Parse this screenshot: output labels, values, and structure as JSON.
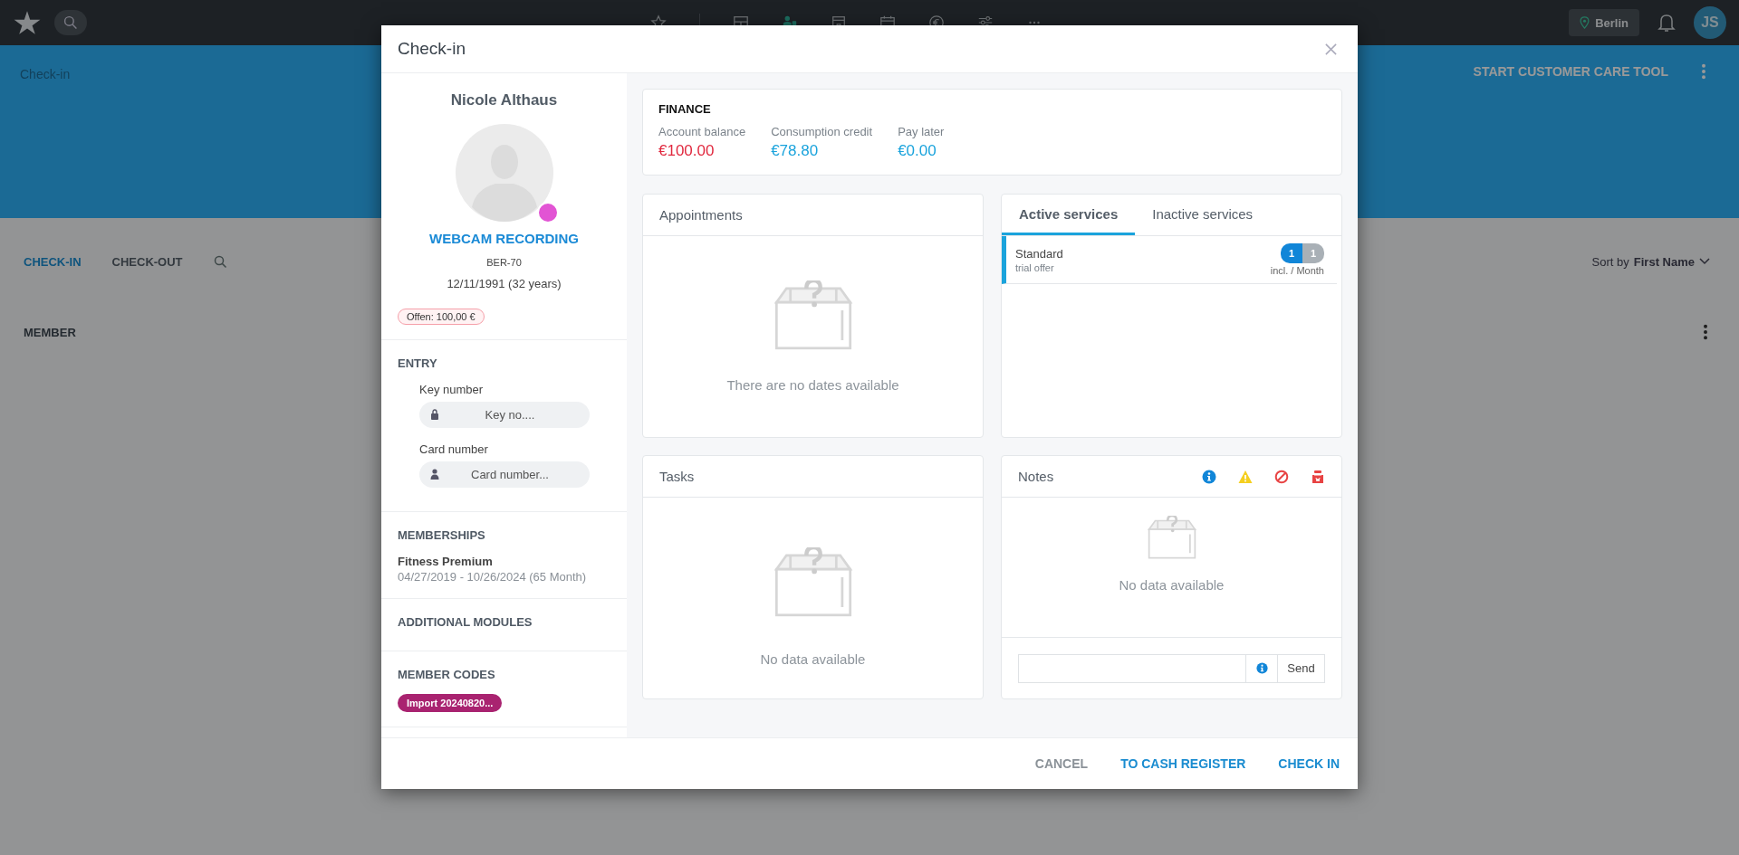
{
  "topbar": {
    "nav": [
      {
        "kind": "star",
        "selected": false
      },
      {
        "kind": "layout",
        "selected": false
      },
      {
        "kind": "members",
        "selected": true
      },
      {
        "kind": "studio",
        "selected": false
      },
      {
        "kind": "calendar",
        "selected": false
      },
      {
        "kind": "euro",
        "selected": false
      },
      {
        "kind": "sliders",
        "selected": false
      },
      {
        "kind": "more",
        "selected": false
      }
    ],
    "location": "Berlin",
    "avatar": "JS"
  },
  "page": {
    "title": "Check-in",
    "action": "START CUSTOMER CARE TOOL",
    "tabs": [
      {
        "label": "CHECK-IN",
        "selected": true
      },
      {
        "label": "CHECK-OUT",
        "selected": false
      }
    ],
    "sort_label": "Sort by",
    "sort_value": "First Name",
    "column": "MEMBER"
  },
  "dialog": {
    "title": "Check-in",
    "member": {
      "name": "Nicole Althaus",
      "link": "WEBCAM RECORDING",
      "number": "BER-70",
      "birth": "12/11/1991 (32 years)",
      "badge": "Offen: 100,00 €"
    },
    "entry": {
      "title": "ENTRY",
      "fields": [
        {
          "kind": "key",
          "label": "Key number",
          "placeholder": "Key no...."
        },
        {
          "kind": "card",
          "label": "Card number",
          "placeholder": "Card number..."
        }
      ]
    },
    "memberships": {
      "title": "MEMBERSHIPS",
      "items": [
        {
          "name": "Fitness Premium",
          "period": "04/27/2019 - 10/26/2024 (65 Month)"
        }
      ]
    },
    "modules": {
      "title": "ADDITIONAL MODULES"
    },
    "codes": {
      "title": "MEMBER CODES",
      "items": [
        "Import 20240820..."
      ]
    },
    "finance": {
      "title": "FINANCE",
      "items": [
        {
          "label": "Account balance",
          "value": "€100.00",
          "color": "#e0283e"
        },
        {
          "label": "Consumption credit",
          "value": "€78.80",
          "color": "#1aa3dc"
        },
        {
          "label": "Pay later",
          "value": "€0.00",
          "color": "#1aa3dc"
        }
      ]
    },
    "appointments": {
      "title": "Appointments",
      "empty": "There are no dates available"
    },
    "services": {
      "tabs": [
        {
          "label": "Active services",
          "selected": true
        },
        {
          "label": "Inactive services",
          "selected": false
        }
      ],
      "items": [
        {
          "name": "Standard",
          "subtitle": "trial offer",
          "used": "1",
          "total": "1",
          "unit": "incl. / Month"
        }
      ]
    },
    "tasks": {
      "title": "Tasks",
      "empty": "No data available"
    },
    "notes": {
      "title": "Notes",
      "icons": [
        {
          "kind": "info"
        },
        {
          "kind": "warning"
        },
        {
          "kind": "blocked"
        },
        {
          "kind": "alarm"
        }
      ],
      "empty": "No data available",
      "send": "Send"
    },
    "buttons": [
      {
        "kind": "secondary",
        "label": "CANCEL"
      },
      {
        "kind": "primary",
        "label": "TO CASH REGISTER"
      },
      {
        "kind": "primary",
        "label": "CHECK IN"
      }
    ]
  }
}
